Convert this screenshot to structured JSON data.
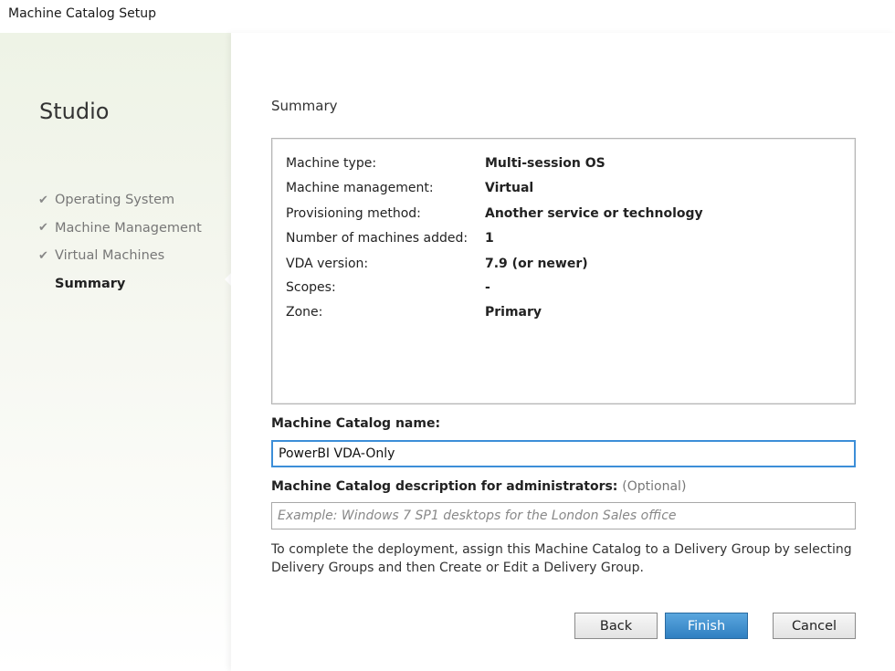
{
  "window": {
    "title": "Machine Catalog Setup"
  },
  "sidebar": {
    "brand": "Studio",
    "steps": [
      {
        "label": "Operating System",
        "done": true
      },
      {
        "label": "Machine Management",
        "done": true
      },
      {
        "label": "Virtual Machines",
        "done": true
      },
      {
        "label": "Summary",
        "done": false,
        "current": true
      }
    ]
  },
  "main": {
    "heading": "Summary",
    "summary": [
      {
        "key": "Machine type:",
        "value": "Multi-session OS"
      },
      {
        "key": "Machine management:",
        "value": "Virtual"
      },
      {
        "key": "Provisioning method:",
        "value": "Another service or technology"
      },
      {
        "key": "Number of machines added:",
        "value": "1"
      },
      {
        "key": "VDA version:",
        "value": "7.9 (or newer)"
      },
      {
        "key": "Scopes:",
        "value": "-"
      },
      {
        "key": "Zone:",
        "value": "Primary"
      }
    ],
    "catalog_name": {
      "label": "Machine Catalog name:",
      "value": "PowerBI VDA-Only"
    },
    "catalog_description": {
      "label": "Machine Catalog description for administrators:",
      "optional": "(Optional)",
      "value": "",
      "placeholder": "Example: Windows 7 SP1 desktops for the London Sales office"
    },
    "note_line1": "To complete the deployment, assign this Machine Catalog to a Delivery Group by selecting",
    "note_line2": "Delivery Groups and then Create or Edit a Delivery Group."
  },
  "buttons": {
    "back": "Back",
    "finish": "Finish",
    "cancel": "Cancel"
  },
  "colors": {
    "accent": "#3c8ed8",
    "primary_button": "#2f7fc1"
  }
}
